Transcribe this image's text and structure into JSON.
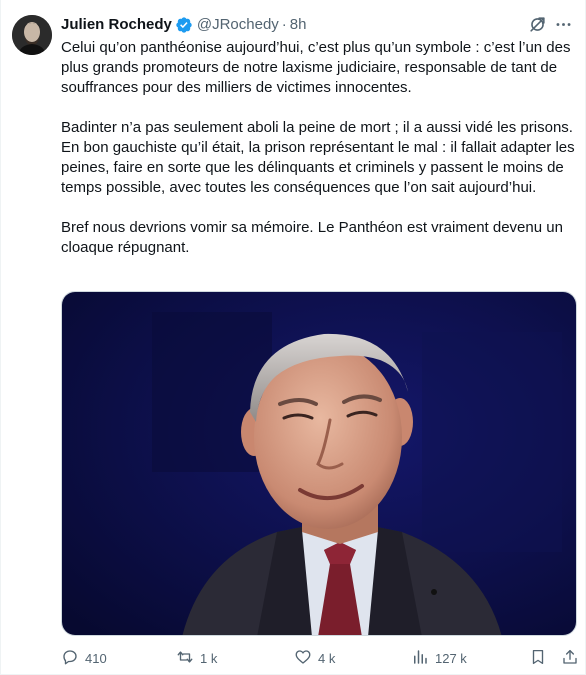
{
  "author": {
    "name": "Julien Rochedy",
    "handle": "@JRochedy",
    "separator": "·",
    "time": "8h"
  },
  "tweet": {
    "paragraphs": [
      "Celui qu’on panthéonise aujourd’hui, c’est plus qu’un symbole : c’est l’un des plus grands promoteurs de notre laxisme judiciaire, responsable de tant de souffrances pour des milliers de victimes innocentes.",
      "Badinter n’a pas seulement aboli la peine de mort ; il a aussi vidé les prisons. En bon gauchiste qu’il était, la prison représentant le mal : il fallait adapter les peines, faire en sorte que les délinquants et criminels y passent le moins de temps possible, avec toutes les conséquences que l’on sait aujourd’hui.",
      "Bref nous devrions vomir sa mémoire. Le Panthéon est vraiment devenu un cloaque répugnant."
    ]
  },
  "actions": {
    "replies": "410",
    "reposts": "1 k",
    "likes": "4 k",
    "views": "127 k"
  },
  "icons": {
    "verified": "verified-badge-icon",
    "grok": "grok-icon",
    "more": "more-icon",
    "reply": "reply-icon",
    "repost": "repost-icon",
    "like": "heart-icon",
    "views": "views-icon",
    "bookmark": "bookmark-icon",
    "share": "share-icon"
  },
  "colors": {
    "verified_blue": "#1d9bf0",
    "text": "#0f1419",
    "muted": "#536471",
    "photo_background": "#0c0f45"
  }
}
